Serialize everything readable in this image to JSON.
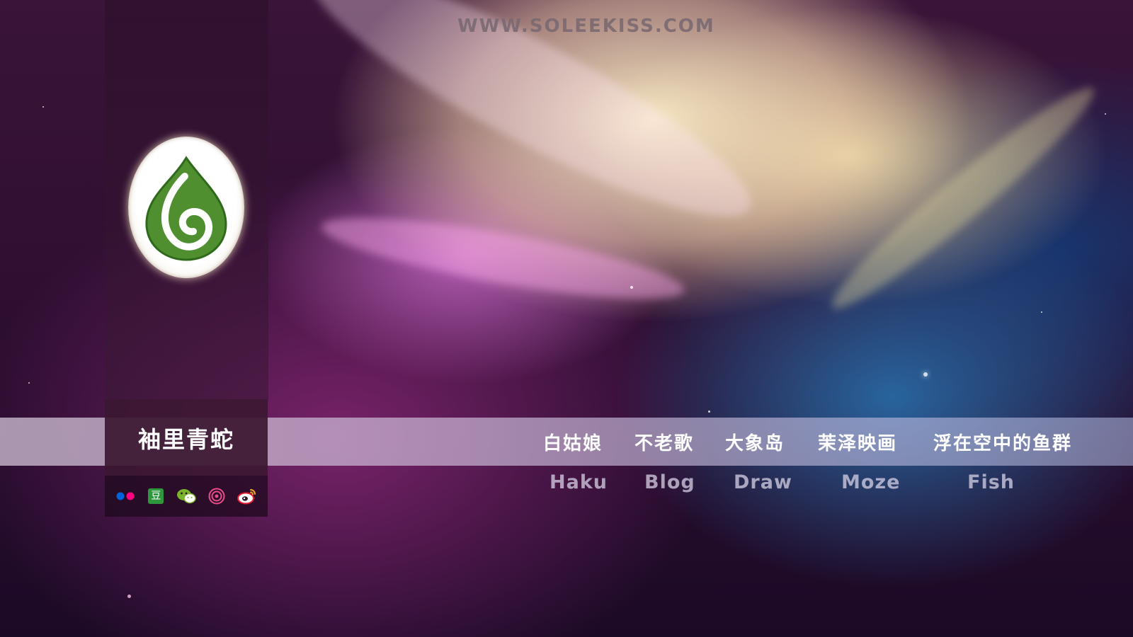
{
  "site": {
    "url_text": "WWW.SOLEEKISS.COM",
    "name": "袖里青蛇"
  },
  "social_icons": [
    "flickr-icon",
    "douban-icon",
    "wechat-icon",
    "dribbble-icon",
    "weibo-icon"
  ],
  "douban_glyph": "豆",
  "nav": {
    "items": [
      {
        "cn": "白姑娘",
        "en": "Haku"
      },
      {
        "cn": "不老歌",
        "en": "Blog"
      },
      {
        "cn": "大象岛",
        "en": "Draw"
      },
      {
        "cn": "茉泽映画",
        "en": "Moze"
      },
      {
        "cn": "浮在空中的鱼群",
        "en": "Fish"
      }
    ]
  },
  "colors": {
    "logo_green": "#4f8f2f",
    "nav_bar": "#cdbed2",
    "sidebar": "#3c1832",
    "flickr_blue": "#0063dc",
    "flickr_pink": "#ff0084",
    "douban_green": "#2e963d",
    "wechat_green": "#7bb32e",
    "dribbble_pink": "#ea4c89",
    "weibo_red": "#e6162d"
  }
}
